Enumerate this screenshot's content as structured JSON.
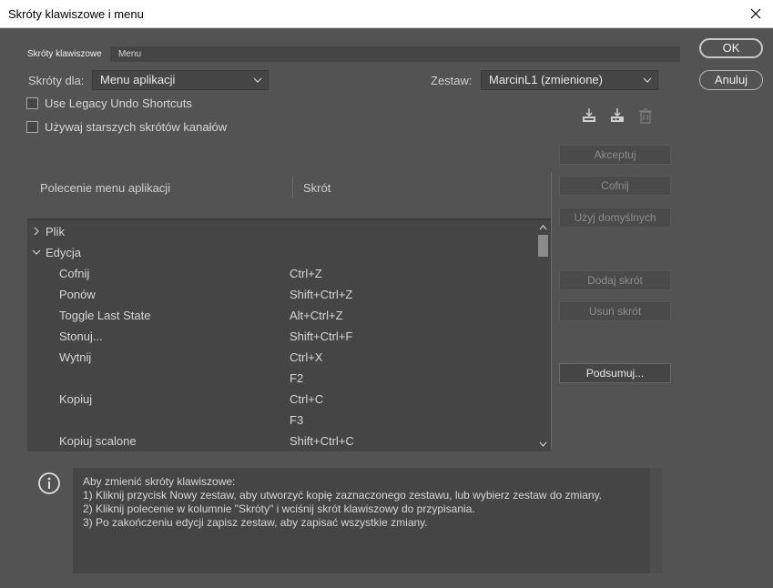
{
  "window": {
    "title": "Skróty klawiszowe i menu"
  },
  "tabs": [
    {
      "label": "Skróty klawiszowe"
    },
    {
      "label": "Menu"
    }
  ],
  "shortcuts_for": {
    "label": "Skróty dla:",
    "value": "Menu aplikacji"
  },
  "set": {
    "label": "Zestaw:",
    "value": "MarcinL1 (zmienione)"
  },
  "checkboxes": [
    {
      "label": "Use Legacy Undo Shortcuts",
      "checked": false
    },
    {
      "label": "Używaj starszych skrótów kanałów",
      "checked": false
    }
  ],
  "icons": {
    "save_set": "save-set-icon",
    "new_set": "new-set-icon",
    "delete_set": "trash-icon",
    "info": "info-icon"
  },
  "columns": {
    "command": "Polecenie menu aplikacji",
    "shortcut": "Skrót"
  },
  "rows": [
    {
      "type": "group",
      "label": "Plik",
      "expanded": false,
      "shortcut": ""
    },
    {
      "type": "group",
      "label": "Edycja",
      "expanded": true,
      "shortcut": ""
    },
    {
      "type": "item",
      "label": "Cofnij",
      "shortcut": "Ctrl+Z"
    },
    {
      "type": "item",
      "label": "Ponów",
      "shortcut": "Shift+Ctrl+Z"
    },
    {
      "type": "item",
      "label": "Toggle Last State",
      "shortcut": "Alt+Ctrl+Z"
    },
    {
      "type": "item",
      "label": "Stonuj...",
      "shortcut": "Shift+Ctrl+F"
    },
    {
      "type": "item",
      "label": "Wytnij",
      "shortcut": "Ctrl+X"
    },
    {
      "type": "item",
      "label": "",
      "shortcut": "F2"
    },
    {
      "type": "item",
      "label": "Kopiuj",
      "shortcut": "Ctrl+C"
    },
    {
      "type": "item",
      "label": "",
      "shortcut": "F3"
    },
    {
      "type": "item",
      "label": "Kopiuj scalone",
      "shortcut": "Shift+Ctrl+C"
    }
  ],
  "side_buttons": {
    "accept": "Akceptuj",
    "undo": "Cofnij",
    "use_default": "Użyj domyślnych",
    "add_shortcut": "Dodaj skrót",
    "remove_shortcut": "Usuń skrót",
    "summarize": "Podsumuj..."
  },
  "dialog_buttons": {
    "ok": "OK",
    "cancel": "Anuluj"
  },
  "info": {
    "lines": [
      "Aby zmienić skróty klawiszowe:",
      "1) Kliknij przycisk Nowy zestaw, aby utworzyć kopię zaznaczonego zestawu, lub wybierz zestaw do zmiany.",
      "2) Kliknij polecenie w kolumnie \"Skróty\" i wciśnij skrót klawiszowy do przypisania.",
      "3) Po zakończeniu edycji zapisz zestaw, aby zapisać wszystkie zmiany."
    ]
  }
}
